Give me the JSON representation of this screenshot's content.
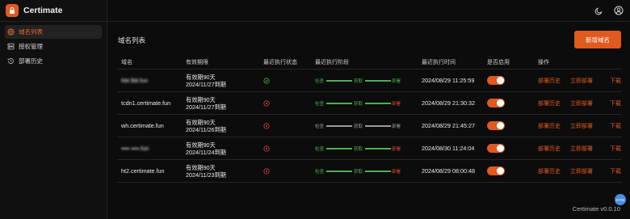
{
  "app": {
    "name": "Certimate",
    "version": "Certimate v0.0.10",
    "avatar_text": "EYM"
  },
  "sidebar": {
    "items": [
      {
        "label": "域名列表",
        "icon": "globe-icon",
        "active": true
      },
      {
        "label": "授权管理",
        "icon": "server-icon",
        "active": false
      },
      {
        "label": "部署历史",
        "icon": "history-icon",
        "active": false
      }
    ]
  },
  "topbar": {
    "theme_icon": "moon-icon",
    "user_icon": "user-circle-icon"
  },
  "main": {
    "title": "域名列表",
    "add_button": "新增域名",
    "columns": {
      "name": "域名",
      "expiry": "有效期限",
      "state": "最近执行状态",
      "stage": "最近执行阶段",
      "time": "最近执行时间",
      "enabled": "是否启用",
      "ops": "操作"
    },
    "stage_labels": {
      "check": "检查",
      "apply": "获取",
      "deploy": "部署"
    },
    "ops_labels": {
      "history": "部署历史",
      "deploy_now": "立即部署",
      "download": "下载"
    },
    "rows": [
      {
        "name": "hbt.lbit.fun",
        "blurred": true,
        "expiry_line1": "有效期90天",
        "expiry_line2": "2024/11/27到期",
        "state": "success",
        "stage_colors": [
          "green",
          "green",
          "green"
        ],
        "time": "2024/08/29 11:25:59",
        "enabled": true
      },
      {
        "name": "tcdn1.certimate.fun",
        "blurred": false,
        "expiry_line1": "有效期90天",
        "expiry_line2": "2024/11/27到期",
        "state": "failed",
        "stage_colors": [
          "green",
          "green",
          "red"
        ],
        "time": "2024/08/29 21:30:32",
        "enabled": true
      },
      {
        "name": "wh.certimate.fun",
        "blurred": false,
        "expiry_line1": "有效期90天",
        "expiry_line2": "2024/11/26到期",
        "state": "failed",
        "stage_colors": [
          "grey",
          "grey",
          "grey"
        ],
        "time": "2024/08/29 21:45:27",
        "enabled": true
      },
      {
        "name": "▪▪▪▪ ▪▪▪▪.fun",
        "blurred": true,
        "expiry_line1": "有效期90天",
        "expiry_line2": "2024/11/24到期",
        "state": "failed",
        "stage_colors": [
          "green",
          "green",
          "red"
        ],
        "time": "2024/08/30 11:24:04",
        "enabled": true
      },
      {
        "name": "ht2.certimate.fun",
        "blurred": false,
        "expiry_line1": "有效期90天",
        "expiry_line2": "2024/11/23到期",
        "state": "failed",
        "stage_colors": [
          "green",
          "green",
          "red"
        ],
        "time": "2024/08/29 08:00:48",
        "enabled": true
      }
    ]
  },
  "colors": {
    "accent": "#e0591f",
    "success": "#4caf50",
    "error": "#e0452b",
    "pending": "#9a9a9a"
  }
}
